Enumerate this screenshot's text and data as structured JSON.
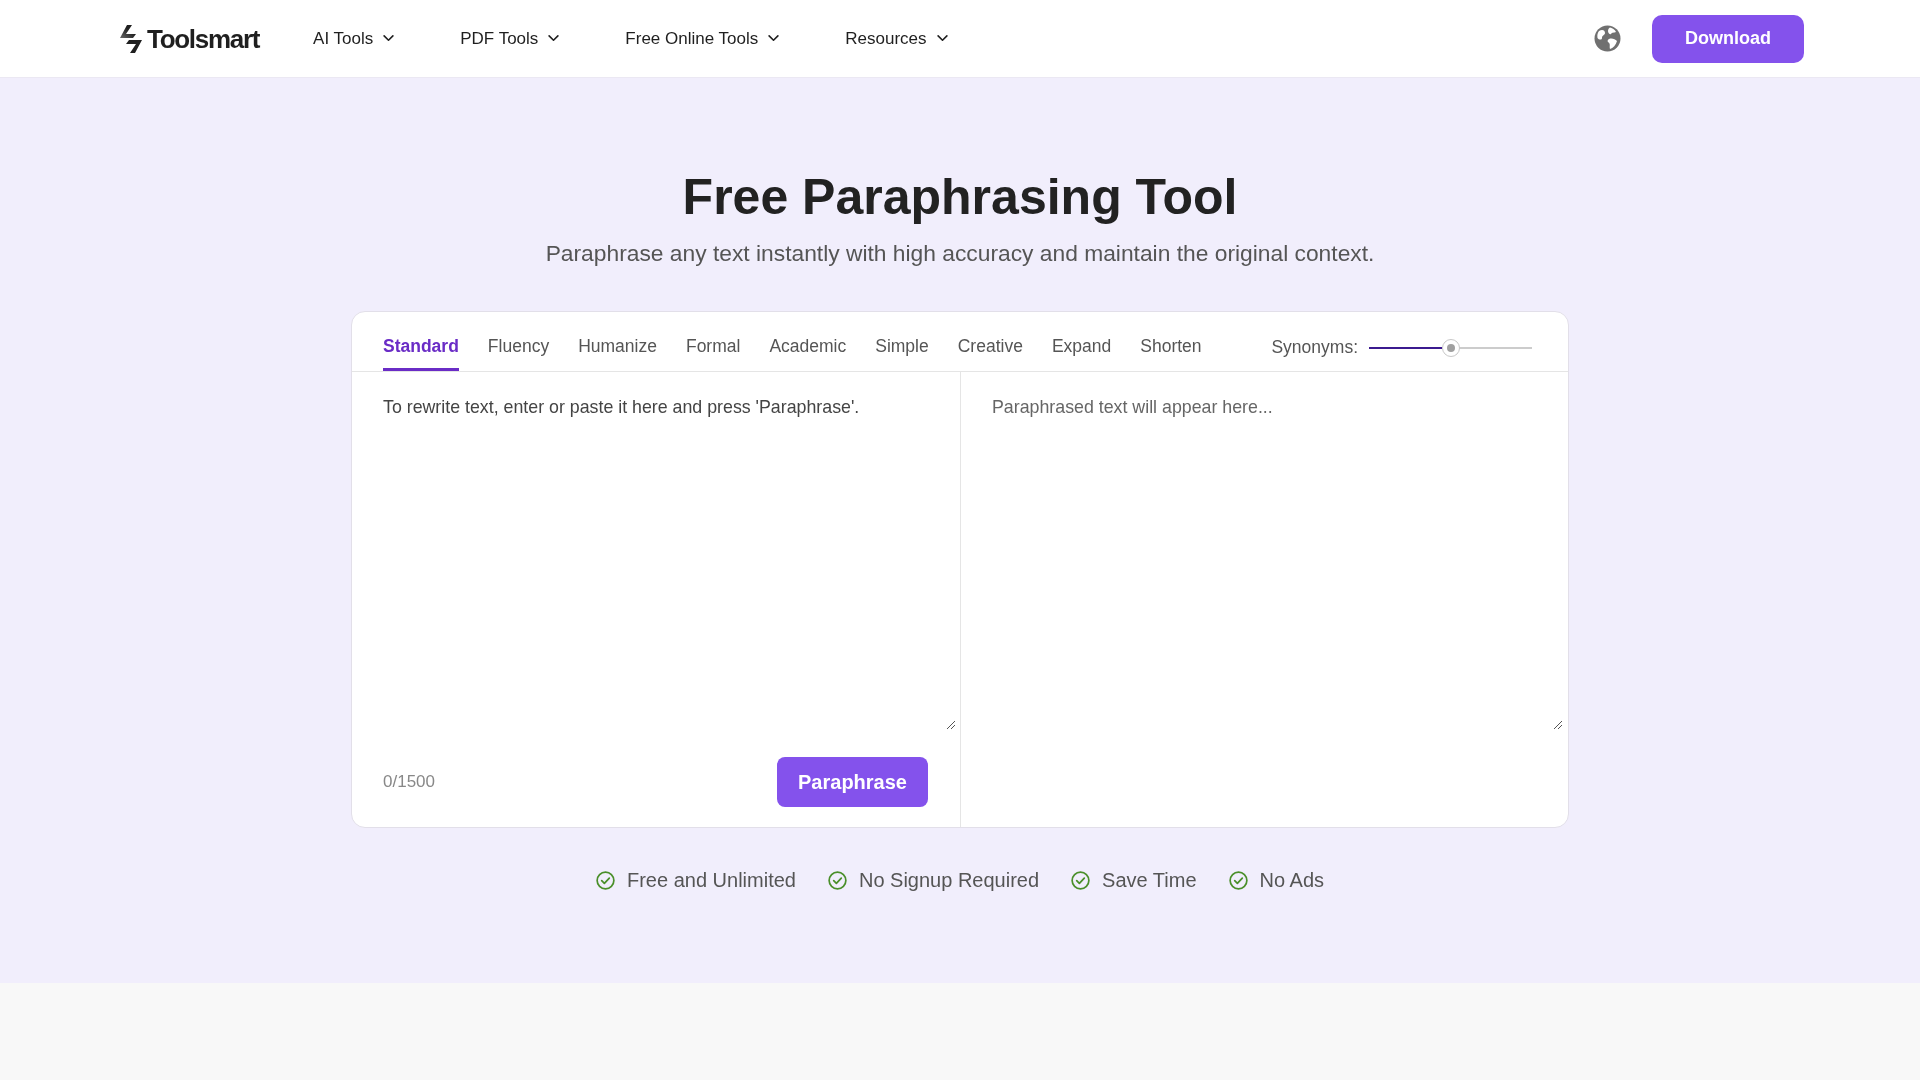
{
  "header": {
    "logo": "Toolsmart",
    "nav": [
      {
        "label": "AI Tools"
      },
      {
        "label": "PDF Tools"
      },
      {
        "label": "Free Online Tools"
      },
      {
        "label": "Resources"
      }
    ],
    "download": "Download"
  },
  "hero": {
    "title": "Free Paraphrasing Tool",
    "subtitle": "Paraphrase any text instantly with high accuracy and maintain the original context."
  },
  "tool": {
    "tabs": [
      {
        "label": "Standard",
        "selected": true
      },
      {
        "label": "Fluency",
        "selected": false
      },
      {
        "label": "Humanize",
        "selected": false
      },
      {
        "label": "Formal",
        "selected": false
      },
      {
        "label": "Academic",
        "selected": false
      },
      {
        "label": "Simple",
        "selected": false
      },
      {
        "label": "Creative",
        "selected": false
      },
      {
        "label": "Expand",
        "selected": false
      },
      {
        "label": "Shorten",
        "selected": false
      }
    ],
    "synonyms": {
      "label": "Synonyms:",
      "level": 0.5
    },
    "input": {
      "placeholder": "To rewrite text, enter or paste it here and press 'Paraphrase'."
    },
    "counter": "0/1500",
    "action": "Paraphrase",
    "output": {
      "placeholder": "Paraphrased text will appear here..."
    }
  },
  "features": [
    {
      "label": "Free and Unlimited"
    },
    {
      "label": "No Signup Required"
    },
    {
      "label": "Save Time"
    },
    {
      "label": "No Ads"
    }
  ]
}
